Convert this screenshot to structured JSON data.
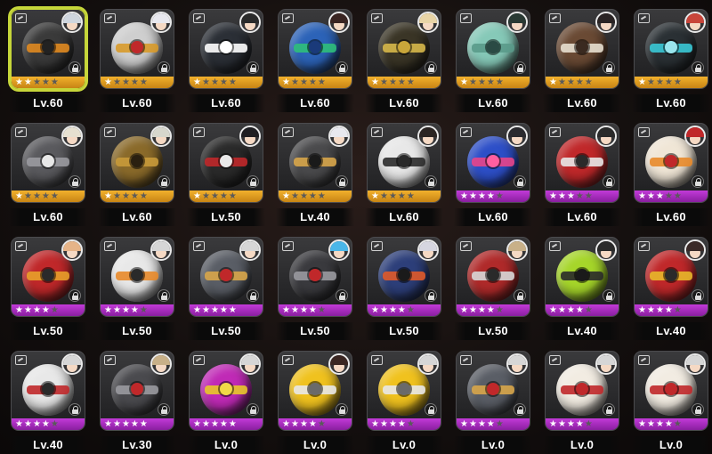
{
  "grid": {
    "items": [
      {
        "level": "Lv.60",
        "stars": 2,
        "rarity": "gold",
        "selected": true,
        "ball_color": "#3a3a3a",
        "band_color": "#e08a20",
        "eye_color": "#222222",
        "hair_color": "#cfd6de",
        "icon": "category-icon"
      },
      {
        "level": "Lv.60",
        "stars": 1,
        "rarity": "gold",
        "selected": false,
        "ball_color": "#cfcfcf",
        "band_color": "#d89a2a",
        "eye_color": "#c0282a",
        "hair_color": "#e8e8ee",
        "icon": "category-icon"
      },
      {
        "level": "Lv.60",
        "stars": 1,
        "rarity": "gold",
        "selected": false,
        "ball_color": "#2b2f36",
        "band_color": "#ffffff",
        "eye_color": "#ffffff",
        "hair_color": "#2a2a2a",
        "icon": "category-icon"
      },
      {
        "level": "Lv.60",
        "stars": 1,
        "rarity": "gold",
        "selected": false,
        "ball_color": "#2c63b8",
        "band_color": "#2fbf7a",
        "eye_color": "#1a3a7a",
        "hair_color": "#3a2522",
        "icon": "category-icon"
      },
      {
        "level": "Lv.60",
        "stars": 1,
        "rarity": "gold",
        "selected": false,
        "ball_color": "#3a3526",
        "band_color": "#d7b84a",
        "eye_color": "#c9a63a",
        "hair_color": "#e8d4a6",
        "icon": "category-icon"
      },
      {
        "level": "Lv.60",
        "stars": 1,
        "rarity": "gold",
        "selected": false,
        "ball_color": "#86c9b8",
        "band_color": "#5a9a8a",
        "eye_color": "#2a4a44",
        "hair_color": "#2a3a34",
        "icon": "category-icon"
      },
      {
        "level": "Lv.60",
        "stars": 1,
        "rarity": "gold",
        "selected": false,
        "ball_color": "#6a4a34",
        "band_color": "#e8e0d0",
        "eye_color": "#3a2a20",
        "hair_color": "#2a2424",
        "icon": "category-icon"
      },
      {
        "level": "Lv.60",
        "stars": 1,
        "rarity": "gold",
        "selected": false,
        "ball_color": "#2a3034",
        "band_color": "#3ac9d6",
        "eye_color": "#9ae6ee",
        "hair_color": "#c8453a",
        "icon": "category-icon"
      },
      {
        "level": "Lv.60",
        "stars": 1,
        "rarity": "gold",
        "selected": false,
        "ball_color": "#5a5a5e",
        "band_color": "#9a9aa0",
        "eye_color": "#e8e8e8",
        "hair_color": "#e6e0d0",
        "icon": "category-icon"
      },
      {
        "level": "Lv.60",
        "stars": 1,
        "rarity": "gold",
        "selected": false,
        "ball_color": "#8a6a2a",
        "band_color": "#c89a3a",
        "eye_color": "#2a2010",
        "hair_color": "#d6d6cc",
        "icon": "category-icon"
      },
      {
        "level": "Lv.50",
        "stars": 1,
        "rarity": "gold",
        "selected": false,
        "ball_color": "#2a2a2a",
        "band_color": "#c0282a",
        "eye_color": "#e8e8e8",
        "hair_color": "#1e1e22",
        "icon": "category-icon"
      },
      {
        "level": "Lv.40",
        "stars": 1,
        "rarity": "gold",
        "selected": false,
        "ball_color": "#4a4a4c",
        "band_color": "#d8a64a",
        "eye_color": "#1a1a1a",
        "hair_color": "#e8e8ee",
        "icon": "category-icon"
      },
      {
        "level": "Lv.60",
        "stars": 1,
        "rarity": "gold",
        "selected": false,
        "ball_color": "#e8e8e8",
        "band_color": "#2a2a2a",
        "eye_color": "#2a2a2a",
        "hair_color": "#2a2422",
        "icon": "category-icon"
      },
      {
        "level": "Lv.60",
        "stars": 4,
        "rarity": "purple",
        "selected": false,
        "ball_color": "#2d4fc8",
        "band_color": "#e8458a",
        "eye_color": "#ff5fa0",
        "hair_color": "#2a2a2e",
        "icon": "category-icon"
      },
      {
        "level": "Lv.60",
        "stars": 3,
        "rarity": "purple",
        "selected": false,
        "ball_color": "#c0282a",
        "band_color": "#e8e8e8",
        "eye_color": "#2a2a2a",
        "hair_color": "#2a2a2a",
        "icon": "category-icon"
      },
      {
        "level": "Lv.60",
        "stars": 3,
        "rarity": "purple",
        "selected": false,
        "ball_color": "#f0e6d6",
        "band_color": "#e88a2a",
        "eye_color": "#c0282a",
        "hair_color": "#c0282a",
        "icon": "category-icon"
      },
      {
        "level": "Lv.50",
        "stars": 4,
        "rarity": "purple",
        "selected": false,
        "ball_color": "#c0282a",
        "band_color": "#e8a02a",
        "eye_color": "#2a2a2a",
        "hair_color": "#e6b488",
        "icon": "category-icon"
      },
      {
        "level": "Lv.50",
        "stars": 4,
        "rarity": "purple",
        "selected": false,
        "ball_color": "#e8e8e8",
        "band_color": "#e88a2a",
        "eye_color": "#2a2a2a",
        "hair_color": "#d6d6d6",
        "icon": "category-icon"
      },
      {
        "level": "Lv.50",
        "stars": 5,
        "rarity": "purple",
        "selected": false,
        "ball_color": "#5a5e66",
        "band_color": "#d8a64a",
        "eye_color": "#c0282a",
        "hair_color": "#d6d6d6",
        "icon": "category-icon"
      },
      {
        "level": "Lv.50",
        "stars": 4,
        "rarity": "purple",
        "selected": false,
        "ball_color": "#3a3a3e",
        "band_color": "#9a9aa0",
        "eye_color": "#c0282a",
        "hair_color": "#4ab6e8",
        "icon": "category-icon"
      },
      {
        "level": "Lv.50",
        "stars": 4,
        "rarity": "purple",
        "selected": false,
        "ball_color": "#2d3f7a",
        "band_color": "#e05a2a",
        "eye_color": "#1a1a1a",
        "hair_color": "#d6d6e0",
        "icon": "category-icon"
      },
      {
        "level": "Lv.50",
        "stars": 4,
        "rarity": "purple",
        "selected": false,
        "ball_color": "#b02a2a",
        "band_color": "#d8d8d8",
        "eye_color": "#2a2a2a",
        "hair_color": "#c8b088",
        "icon": "category-icon"
      },
      {
        "level": "Lv.40",
        "stars": 4,
        "rarity": "purple",
        "selected": false,
        "ball_color": "#a6d62a",
        "band_color": "#2a2a2a",
        "eye_color": "#1a1a1a",
        "hair_color": "#2a2a2a",
        "icon": "category-icon"
      },
      {
        "level": "Lv.40",
        "stars": 4,
        "rarity": "purple",
        "selected": false,
        "ball_color": "#c0282a",
        "band_color": "#e8b82a",
        "eye_color": "#2a2a2a",
        "hair_color": "#3a2a28",
        "icon": "category-icon"
      },
      {
        "level": "Lv.40",
        "stars": 4,
        "rarity": "purple",
        "selected": false,
        "ball_color": "#e8e8e8",
        "band_color": "#c0282a",
        "eye_color": "#2a2a2a",
        "hair_color": "#d6d6d6",
        "icon": "category-icon"
      },
      {
        "level": "Lv.30",
        "stars": 5,
        "rarity": "purple",
        "selected": false,
        "ball_color": "#4a4a4e",
        "band_color": "#9a9aa0",
        "eye_color": "#c0282a",
        "hair_color": "#c8b088",
        "icon": "category-icon"
      },
      {
        "level": "Lv.0",
        "stars": 5,
        "rarity": "purple",
        "selected": false,
        "ball_color": "#c02ab6",
        "band_color": "#e8c82a",
        "eye_color": "#f0d848",
        "hair_color": "#d6d6d6",
        "icon": "category-icon"
      },
      {
        "level": "Lv.0",
        "stars": 4,
        "rarity": "purple",
        "selected": false,
        "ball_color": "#f0c21e",
        "band_color": "#e8e8e8",
        "eye_color": "#6a6a6a",
        "hair_color": "#3a2622",
        "icon": "category-icon"
      },
      {
        "level": "Lv.0",
        "stars": 4,
        "rarity": "purple",
        "selected": false,
        "ball_color": "#f0c21e",
        "band_color": "#e8e8e8",
        "eye_color": "#6a6a6a",
        "hair_color": "#d6d6d6",
        "icon": "category-icon"
      },
      {
        "level": "Lv.0",
        "stars": 4,
        "rarity": "purple",
        "selected": false,
        "ball_color": "#5a5e66",
        "band_color": "#d8a64a",
        "eye_color": "#c0282a",
        "hair_color": "#d6d6d6",
        "icon": "category-icon"
      },
      {
        "level": "Lv.0",
        "stars": 4,
        "rarity": "purple",
        "selected": false,
        "ball_color": "#f2ece2",
        "band_color": "#c0282a",
        "eye_color": "#c0282a",
        "hair_color": "#d6d6d6",
        "icon": "category-icon"
      },
      {
        "level": "Lv.0",
        "stars": 4,
        "rarity": "purple",
        "selected": false,
        "ball_color": "#f2ece2",
        "band_color": "#c0282a",
        "eye_color": "#c0282a",
        "hair_color": "#d6d6d6",
        "icon": "category-icon"
      }
    ]
  }
}
